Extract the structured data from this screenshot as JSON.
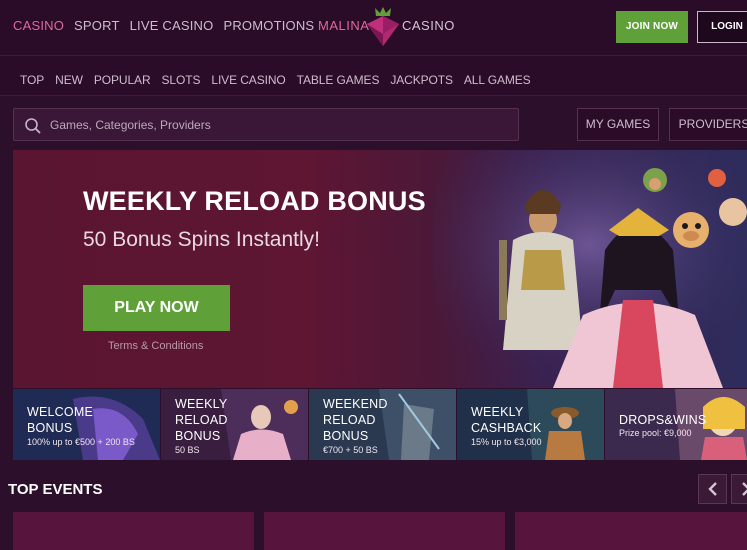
{
  "header": {
    "nav": [
      "CASINO",
      "SPORT",
      "LIVE CASINO",
      "PROMOTIONS"
    ],
    "active_nav": "CASINO",
    "brand_left": "MALINA",
    "brand_right": "CASINO",
    "join_label": "JOIN NOW",
    "login_label": "LOGIN"
  },
  "categories": [
    "TOP",
    "NEW",
    "POPULAR",
    "SLOTS",
    "LIVE CASINO",
    "TABLE GAMES",
    "JACKPOTS",
    "ALL GAMES"
  ],
  "search": {
    "placeholder": "Games, Categories, Providers",
    "my_games_label": "MY GAMES",
    "providers_label": "PROVIDERS"
  },
  "hero": {
    "title": "WEEKLY RELOAD BONUS",
    "subtitle": "50 Bonus Spins Instantly!",
    "cta_label": "PLAY NOW",
    "terms_label": "Terms & Conditions"
  },
  "promos": [
    {
      "title_line1": "WELCOME",
      "title_line2": "BONUS",
      "title_line3": "",
      "subtitle": "100% up to €500 + 200 BS"
    },
    {
      "title_line1": "WEEKLY",
      "title_line2": "RELOAD",
      "title_line3": "BONUS",
      "subtitle": "50 BS"
    },
    {
      "title_line1": "WEEKEND",
      "title_line2": "RELOAD",
      "title_line3": "BONUS",
      "subtitle": "€700 + 50 BS"
    },
    {
      "title_line1": "WEEKLY",
      "title_line2": "CASHBACK",
      "title_line3": "",
      "subtitle": "15% up to €3,000"
    },
    {
      "title_line1": "DROPS&WINS",
      "title_line2": "",
      "title_line3": "",
      "subtitle": "Prize pool: €9,000"
    }
  ],
  "events": {
    "title": "TOP EVENTS",
    "prev_icon": "chevron-left-icon",
    "next_icon": "chevron-right-icon"
  },
  "colors": {
    "accent_pink": "#e0699e",
    "cta_green": "#5fa038",
    "page_bg": "#2b0f2b"
  }
}
